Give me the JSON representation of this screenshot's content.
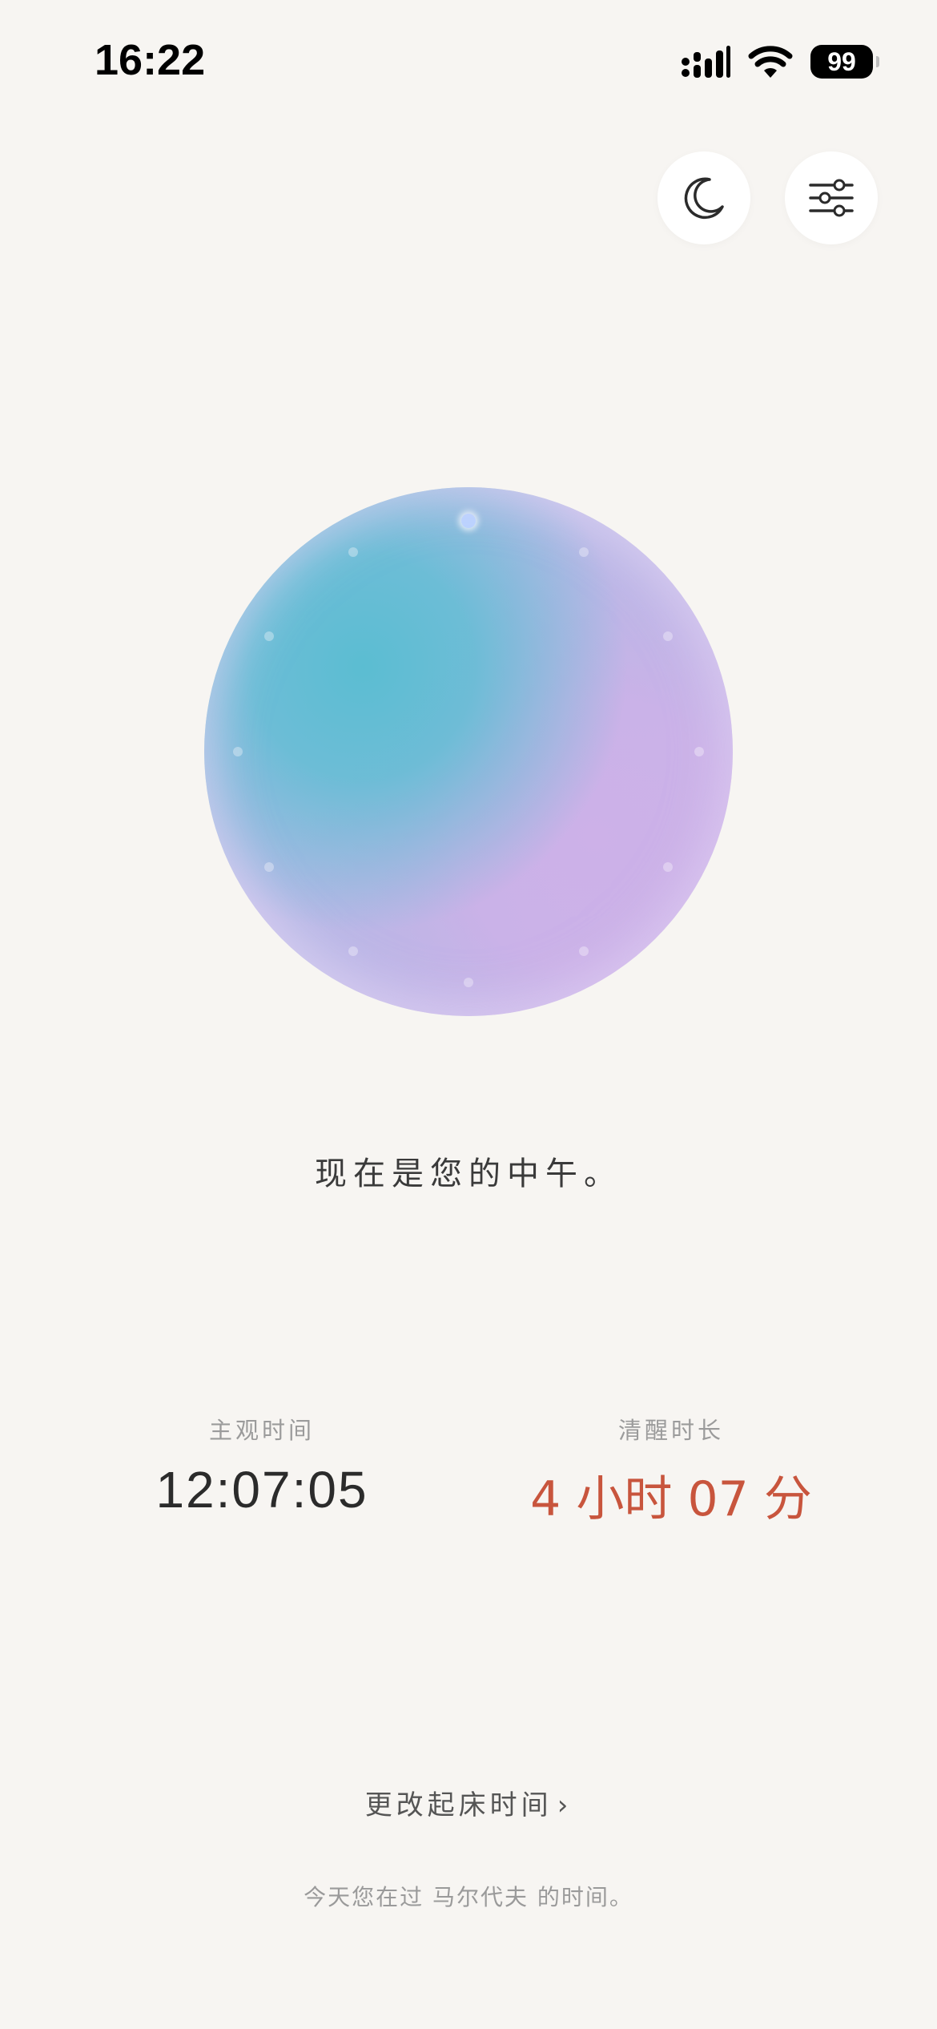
{
  "status_bar": {
    "time": "16:22",
    "battery": "99",
    "icons": [
      "signal-icon",
      "wifi-icon",
      "battery-icon"
    ]
  },
  "top_buttons": {
    "moon_icon": "moon-icon",
    "settings_icon": "sliders-icon"
  },
  "orb": {
    "colors": {
      "cyan": "#5bbdd2",
      "lavender": "#cdb1e8"
    },
    "tick_count": 12,
    "active_tick_index": 0
  },
  "headline": "现在是您的中午。",
  "stats": {
    "subjective_time": {
      "label": "主观时间",
      "value": "12:07:05"
    },
    "awake_duration": {
      "label": "清醒时长",
      "value": "4 小时 07 分",
      "color": "#c8553d"
    }
  },
  "change_wake_time": {
    "label": "更改起床时间",
    "chevron": "›"
  },
  "footer_note": "今天您在过 马尔代夫 的时间。",
  "colors": {
    "background": "#f7f5f2",
    "accent": "#c8553d"
  }
}
